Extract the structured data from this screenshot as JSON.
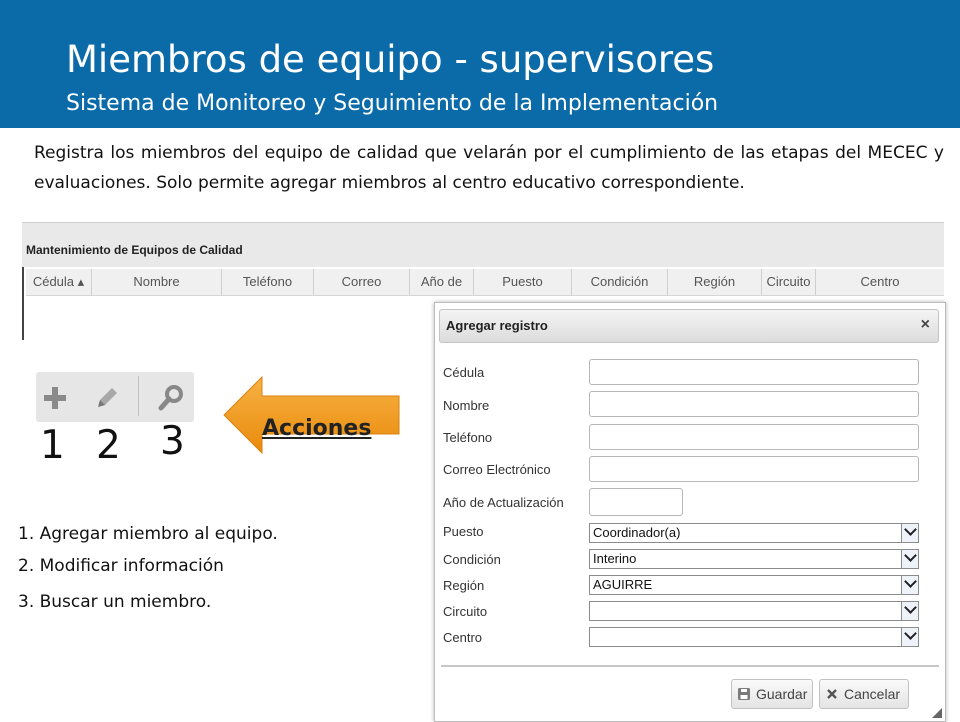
{
  "header": {
    "title": "Miembros de equipo - supervisores",
    "subtitle": "Sistema de Monitoreo y Seguimiento de la Implementación"
  },
  "description": "Registra los miembros del equipo de calidad que velarán por el cumplimiento de las etapas del MECEC y evaluaciones. Solo permite agregar miembros al centro educativo correspondiente.",
  "grid": {
    "title": "Mantenimiento de Equipos de Calidad",
    "columns": [
      "Cédula",
      "Nombre",
      "Teléfono",
      "Correo",
      "Año de",
      "Puesto",
      "Condición",
      "Región",
      "Circuito",
      "Centro"
    ]
  },
  "toolbar": {
    "icons": [
      "add-icon",
      "pencil-icon",
      "search-icon"
    ],
    "numbers": [
      "1",
      "2",
      "3"
    ]
  },
  "actions_label": "Acciones",
  "legend": [
    "1. Agregar miembro al equipo.",
    "2. Modificar información",
    "3. Buscar un miembro."
  ],
  "dialog": {
    "title": "Agregar registro",
    "close": "×",
    "fields": {
      "cedula": {
        "label": "Cédula",
        "value": ""
      },
      "nombre": {
        "label": "Nombre",
        "value": ""
      },
      "telefono": {
        "label": "Teléfono",
        "value": ""
      },
      "correo": {
        "label": "Correo Electrónico",
        "value": ""
      },
      "anio": {
        "label": "Año de Actualización",
        "value": ""
      },
      "puesto": {
        "label": "Puesto",
        "value": "Coordinador(a)"
      },
      "condicion": {
        "label": "Condición",
        "value": "Interino"
      },
      "region": {
        "label": "Región",
        "value": "AGUIRRE"
      },
      "circuito": {
        "label": "Circuito",
        "value": ""
      },
      "centro": {
        "label": "Centro",
        "value": ""
      }
    },
    "save": "Guardar",
    "cancel": "Cancelar"
  },
  "colors": {
    "header_bg": "#0b6aa8",
    "arrow": "#f39a17"
  }
}
